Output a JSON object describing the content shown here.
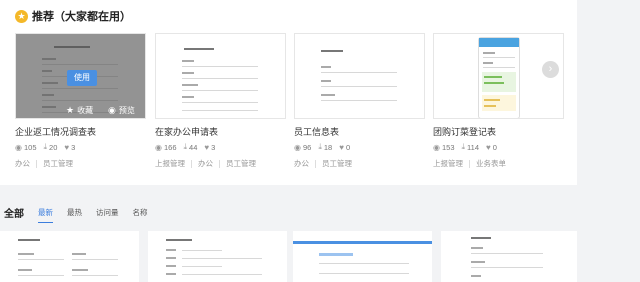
{
  "recommend": {
    "title": "推荐（大家都在用）",
    "star_icon": "star-icon",
    "accent": "#f4b829",
    "hover": {
      "use_label": "使用",
      "favorite_label": "收藏",
      "preview_label": "预览"
    }
  },
  "cards": [
    {
      "title": "企业返工情况调查表",
      "views": "105",
      "downloads": "20",
      "likes": "3",
      "tags": [
        "办公",
        "员工管理"
      ]
    },
    {
      "title": "在家办公申请表",
      "views": "166",
      "downloads": "44",
      "likes": "3",
      "tags": [
        "上报管理",
        "办公",
        "员工管理"
      ]
    },
    {
      "title": "员工信息表",
      "views": "96",
      "downloads": "18",
      "likes": "0",
      "tags": [
        "办公",
        "员工管理"
      ]
    },
    {
      "title": "团购订菜登记表",
      "views": "153",
      "downloads": "114",
      "likes": "0",
      "tags": [
        "上报管理",
        "业务表单"
      ]
    }
  ],
  "all_section": {
    "title": "全部",
    "tabs": [
      {
        "label": "最新",
        "active": true
      },
      {
        "label": "最热",
        "active": false
      },
      {
        "label": "访问量",
        "active": false
      },
      {
        "label": "名称",
        "active": false
      }
    ],
    "accent": "#3b7ddd"
  }
}
